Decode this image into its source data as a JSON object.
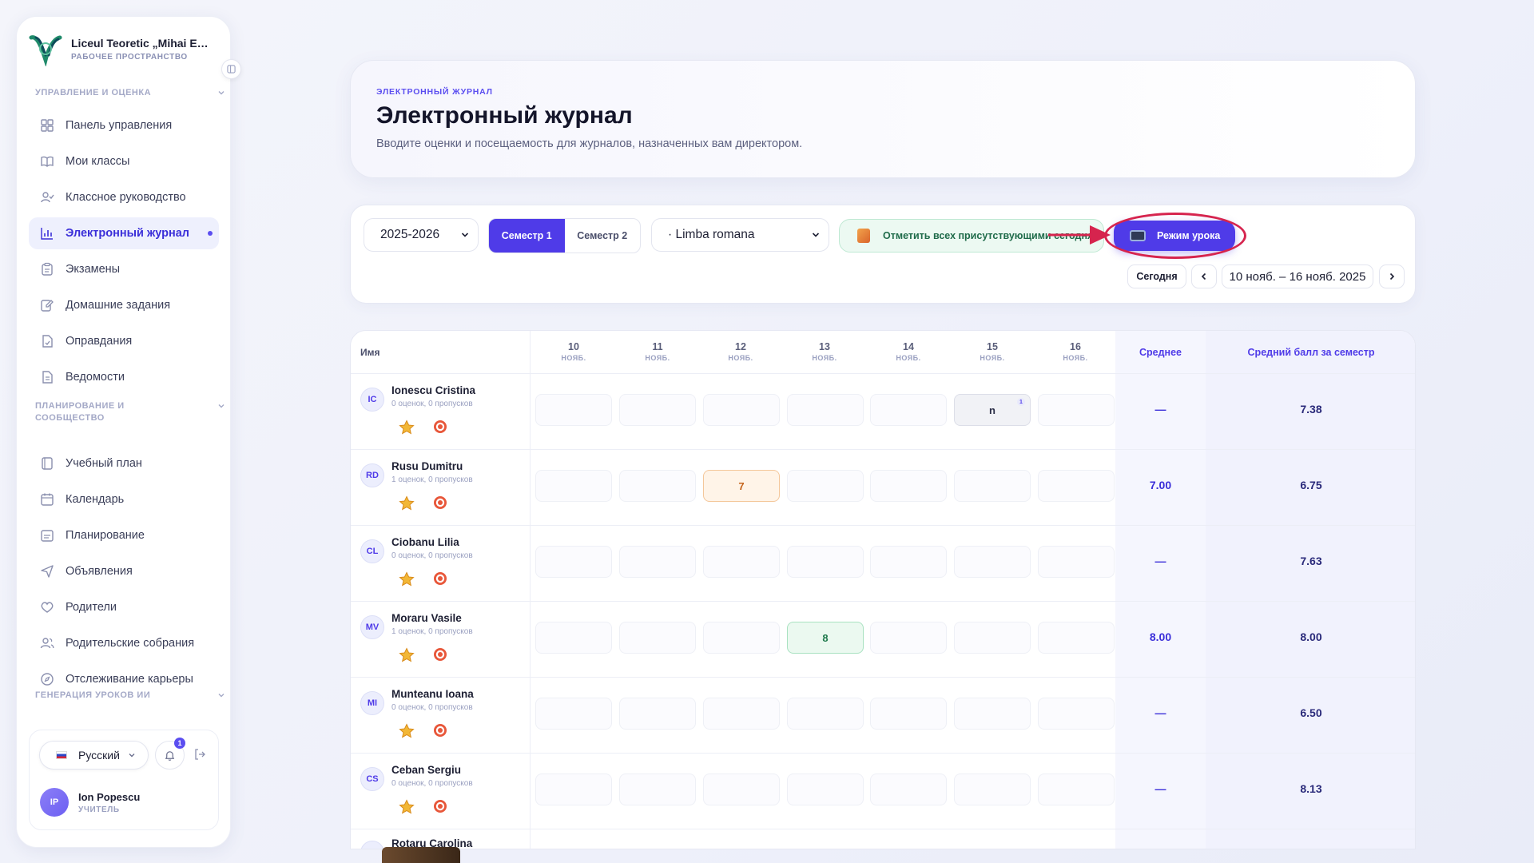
{
  "sidebar": {
    "school_name": "Liceul Teoretic „Mihai Eminescu”",
    "workspace_label": "РАБОЧЕЕ ПРОСТРАНСТВО",
    "sections": [
      {
        "title": "УПРАВЛЕНИЕ И ОЦЕНКА"
      },
      {
        "title": "ПЛАНИРОВАНИЕ И СООБЩЕСТВО"
      },
      {
        "title": "ГЕНЕРАЦИЯ УРОКОВ ИИ"
      }
    ],
    "items": [
      {
        "label": "Панель управления",
        "icon": "grid-icon"
      },
      {
        "label": "Мои классы",
        "icon": "book-open-icon"
      },
      {
        "label": "Классное руководство",
        "icon": "user-check-icon"
      },
      {
        "label": "Электронный журнал",
        "icon": "bar-chart-icon",
        "active": true
      },
      {
        "label": "Экзамены",
        "icon": "clipboard-icon"
      },
      {
        "label": "Домашние задания",
        "icon": "edit-icon"
      },
      {
        "label": "Оправдания",
        "icon": "file-check-icon"
      },
      {
        "label": "Ведомости",
        "icon": "file-text-icon"
      },
      {
        "label": "Учебный план",
        "icon": "notebook-icon"
      },
      {
        "label": "Календарь",
        "icon": "calendar-icon"
      },
      {
        "label": "Планирование",
        "icon": "calendar-list-icon"
      },
      {
        "label": "Объявления",
        "icon": "send-icon"
      },
      {
        "label": "Родители",
        "icon": "heart-icon"
      },
      {
        "label": "Родительские собрания",
        "icon": "users-icon"
      },
      {
        "label": "Отслеживание карьеры",
        "icon": "compass-icon"
      }
    ],
    "language": "Русский",
    "notifications_count": "1",
    "user": {
      "initials": "IP",
      "name": "Ion Popescu",
      "role": "УЧИТЕЛЬ"
    }
  },
  "header": {
    "eyebrow": "ЭЛЕКТРОННЫЙ ЖУРНАЛ",
    "title": "Электронный журнал",
    "subtitle": "Вводите оценки и посещаемость для журналов, назначенных вам директором."
  },
  "toolbar": {
    "year": "2025-2026",
    "semesters": [
      "Семестр 1",
      "Семестр 2"
    ],
    "subject": "· Limba romana",
    "mark_all_label": "Отметить всех присутствующими сегодня",
    "lesson_mode_label": "Режим урока",
    "today_label": "Сегодня",
    "date_range": "10 нояб. – 16 нояб. 2025",
    "colors": {
      "accent": "#4f3be8",
      "annotation": "#d6244e"
    }
  },
  "table": {
    "name_header": "Имя",
    "days": [
      {
        "day": "10",
        "month": "НОЯБ."
      },
      {
        "day": "11",
        "month": "НОЯБ."
      },
      {
        "day": "12",
        "month": "НОЯБ."
      },
      {
        "day": "13",
        "month": "НОЯБ."
      },
      {
        "day": "14",
        "month": "НОЯБ."
      },
      {
        "day": "15",
        "month": "НОЯБ."
      },
      {
        "day": "16",
        "month": "НОЯБ."
      }
    ],
    "avg_header": "Среднее",
    "sem_header": "Средний балл за семестр",
    "students": [
      {
        "initials": "IC",
        "name": "Ionescu Cristina",
        "meta": "0 оценок, 0 пропусков",
        "avg": "—",
        "sem": "7.38",
        "cells": [
          "",
          "",
          "",
          "",
          "",
          "n",
          ""
        ],
        "cell_note": "1"
      },
      {
        "initials": "RD",
        "name": "Rusu Dumitru",
        "meta": "1 оценок, 0 пропусков",
        "avg": "7.00",
        "sem": "6.75",
        "cells": [
          "",
          "",
          "7",
          "",
          "",
          "",
          ""
        ]
      },
      {
        "initials": "CL",
        "name": "Ciobanu Lilia",
        "meta": "0 оценок, 0 пропусков",
        "avg": "—",
        "sem": "7.63",
        "cells": [
          "",
          "",
          "",
          "",
          "",
          "",
          ""
        ]
      },
      {
        "initials": "MV",
        "name": "Moraru Vasile",
        "meta": "1 оценок, 0 пропусков",
        "avg": "8.00",
        "sem": "8.00",
        "cells": [
          "",
          "",
          "",
          "8",
          "",
          "",
          ""
        ]
      },
      {
        "initials": "MI",
        "name": "Munteanu Ioana",
        "meta": "0 оценок, 0 пропусков",
        "avg": "—",
        "sem": "6.50",
        "cells": [
          "",
          "",
          "",
          "",
          "",
          "",
          ""
        ]
      },
      {
        "initials": "CS",
        "name": "Ceban Sergiu",
        "meta": "0 оценок, 0 пропусков",
        "avg": "—",
        "sem": "8.13",
        "cells": [
          "",
          "",
          "",
          "",
          "",
          "",
          ""
        ]
      }
    ],
    "partial_student": "Rotaru Carolina"
  }
}
